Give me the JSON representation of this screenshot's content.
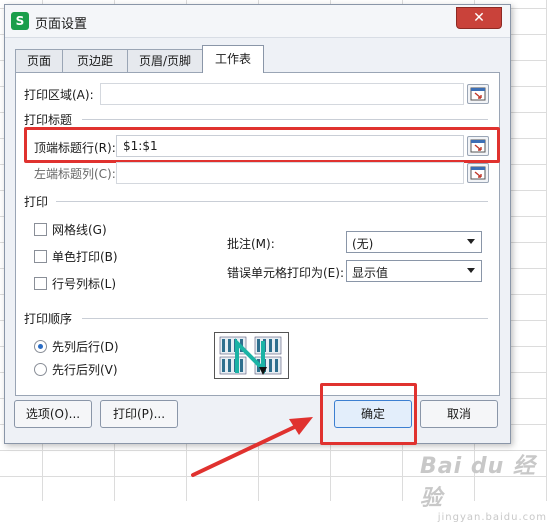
{
  "dialog": {
    "title": "页面设置",
    "app_icon_letter": "S",
    "close_label": "✕"
  },
  "tabs": [
    {
      "label": "页面",
      "active": false
    },
    {
      "label": "页边距",
      "active": false
    },
    {
      "label": "页眉/页脚",
      "active": false
    },
    {
      "label": "工作表",
      "active": true
    }
  ],
  "print_area": {
    "label": "打印区域(A):",
    "value": ""
  },
  "print_titles": {
    "group_label": "打印标题",
    "top_rows": {
      "label": "顶端标题行(R):",
      "value": "$1:$1"
    },
    "left_cols": {
      "label": "左端标题列(C):",
      "value": ""
    }
  },
  "print_group": {
    "group_label": "打印",
    "checkboxes": [
      {
        "label": "网格线(G)",
        "checked": false
      },
      {
        "label": "单色打印(B)",
        "checked": false
      },
      {
        "label": "行号列标(L)",
        "checked": false
      }
    ],
    "comments": {
      "label": "批注(M):",
      "value": "(无)"
    },
    "errors": {
      "label": "错误单元格打印为(E):",
      "value": "显示值"
    }
  },
  "print_order": {
    "group_label": "打印顺序",
    "options": [
      {
        "label": "先列后行(D)",
        "selected": true
      },
      {
        "label": "先行后列(V)",
        "selected": false
      }
    ]
  },
  "buttons": {
    "options": "选项(O)...",
    "print": "打印(P)...",
    "ok": "确定",
    "cancel": "取消"
  },
  "watermark": {
    "main": "Bai du 经验",
    "sub": "jingyan.baidu.com"
  },
  "colors": {
    "highlight": "#e0322f",
    "annotation_arrow": "#e0322f",
    "app_icon": "#1a9e4b"
  }
}
